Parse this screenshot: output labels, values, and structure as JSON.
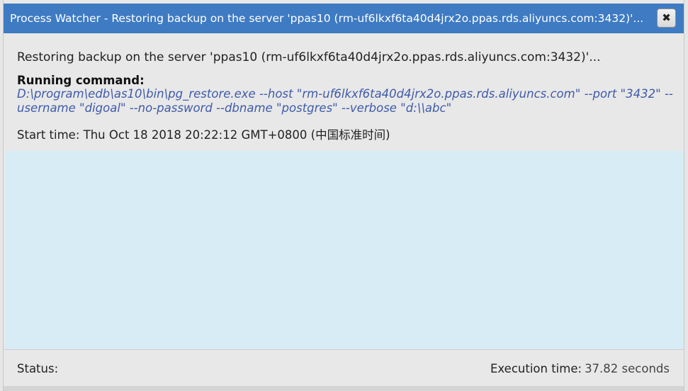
{
  "dialog": {
    "title": "Process Watcher - Restoring backup on the server 'ppas10 (rm-uf6lkxf6ta40d4jrx2o.ppas.rds.aliyuncs.com:3432)'...",
    "close_label": "✖"
  },
  "details": {
    "description": "Restoring backup on the server 'ppas10 (rm-uf6lkxf6ta40d4jrx2o.ppas.rds.aliyuncs.com:3432)'...",
    "running_command_label": "Running command:",
    "command": "D:\\program\\edb\\as10\\bin\\pg_restore.exe --host \"rm-uf6lkxf6ta40d4jrx2o.ppas.rds.aliyuncs.com\" --port \"3432\" --username \"digoal\" --no-password --dbname \"postgres\" --verbose \"d:\\\\abc\"",
    "start_time_label": "Start time:",
    "start_time_value": "Thu Oct 18 2018 20:22:12 GMT+0800 (中国标准时间)"
  },
  "footer": {
    "status_label": "Status:",
    "execution_time_label": "Execution time:",
    "execution_time_value": "37.82 seconds"
  }
}
